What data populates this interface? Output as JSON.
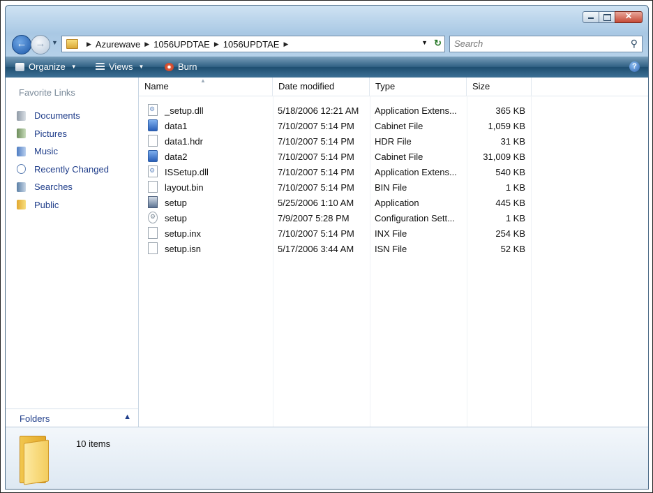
{
  "window": {
    "controls": {
      "minimize_icon": "minimize-icon",
      "maximize_icon": "maximize-icon",
      "close_icon": "close-icon"
    }
  },
  "address": {
    "breadcrumbs": [
      "Azurewave",
      "1056UPDTAE",
      "1056UPDTAE"
    ],
    "search_placeholder": "Search"
  },
  "toolbar": {
    "organize": "Organize",
    "views": "Views",
    "burn": "Burn"
  },
  "navpane": {
    "favorite_links_title": "Favorite Links",
    "links": [
      {
        "label": "Documents",
        "icon": "documents-icon"
      },
      {
        "label": "Pictures",
        "icon": "pictures-icon"
      },
      {
        "label": "Music",
        "icon": "music-icon"
      },
      {
        "label": "Recently Changed",
        "icon": "recently-changed-icon"
      },
      {
        "label": "Searches",
        "icon": "searches-icon"
      },
      {
        "label": "Public",
        "icon": "public-folder-icon"
      }
    ],
    "folders_label": "Folders"
  },
  "filelist": {
    "columns": {
      "name": "Name",
      "date": "Date modified",
      "type": "Type",
      "size": "Size"
    },
    "files": [
      {
        "name": "_setup.dll",
        "date": "5/18/2006 12:21 AM",
        "type": "Application Extens...",
        "size": "365 KB",
        "icon": "dll"
      },
      {
        "name": "data1",
        "date": "7/10/2007 5:14 PM",
        "type": "Cabinet File",
        "size": "1,059 KB",
        "icon": "cab"
      },
      {
        "name": "data1.hdr",
        "date": "7/10/2007 5:14 PM",
        "type": "HDR File",
        "size": "31 KB",
        "icon": "doc"
      },
      {
        "name": "data2",
        "date": "7/10/2007 5:14 PM",
        "type": "Cabinet File",
        "size": "31,009 KB",
        "icon": "cab"
      },
      {
        "name": "ISSetup.dll",
        "date": "7/10/2007 5:14 PM",
        "type": "Application Extens...",
        "size": "540 KB",
        "icon": "dll"
      },
      {
        "name": "layout.bin",
        "date": "7/10/2007 5:14 PM",
        "type": "BIN File",
        "size": "1 KB",
        "icon": "doc"
      },
      {
        "name": "setup",
        "date": "5/25/2006 1:10 AM",
        "type": "Application",
        "size": "445 KB",
        "icon": "exe"
      },
      {
        "name": "setup",
        "date": "7/9/2007 5:28 PM",
        "type": "Configuration Sett...",
        "size": "1 KB",
        "icon": "ini"
      },
      {
        "name": "setup.inx",
        "date": "7/10/2007 5:14 PM",
        "type": "INX File",
        "size": "254 KB",
        "icon": "doc"
      },
      {
        "name": "setup.isn",
        "date": "5/17/2006 3:44 AM",
        "type": "ISN File",
        "size": "52 KB",
        "icon": "doc"
      }
    ]
  },
  "details": {
    "item_count": "10 items"
  }
}
